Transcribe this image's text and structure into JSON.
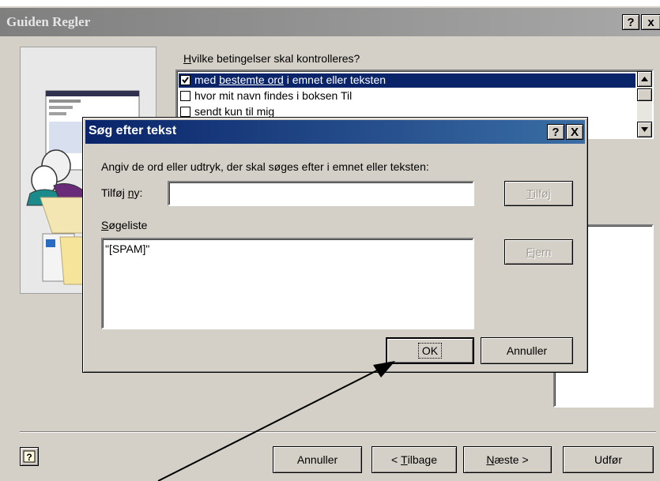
{
  "wizard": {
    "title": "Guiden Regler",
    "help_btn": "?",
    "close_btn": "x",
    "question_pre": "",
    "question_ul": "H",
    "question_post": "vilke betingelser skal kontrolleres?",
    "conditions": [
      {
        "checked": true,
        "pre": "med ",
        "ul": "bestemte ord",
        "post": " i emnet eller teksten",
        "selected": true
      },
      {
        "checked": false,
        "pre": "hvor mit navn findes i boksen Til",
        "ul": "",
        "post": "",
        "selected": false
      },
      {
        "checked": false,
        "pre": "sendt kun til mig",
        "ul": "",
        "post": "",
        "selected": false
      }
    ],
    "buttons": {
      "cancel": "Annuller",
      "back_pre": "< ",
      "back_ul": "T",
      "back_post": "ilbage",
      "next_ul": "N",
      "next_post": "æste >",
      "finish": "Udfør"
    },
    "help_icon": "help-question-icon"
  },
  "dialog": {
    "title": "Søg efter tekst",
    "help_btn": "?",
    "close_btn": "X",
    "instruction": "Angiv de ord eller udtryk, der skal søges efter i emnet eller teksten:",
    "add_label_pre": "Tilføj ",
    "add_label_ul": "n",
    "add_label_post": "y:",
    "add_value": "",
    "add_btn_ul": "T",
    "add_btn_post": "ilføj",
    "list_label_pre": "",
    "list_label_ul": "S",
    "list_label_post": "øgeliste",
    "list_items": [
      "\"[SPAM]\""
    ],
    "remove_btn_ul": "F",
    "remove_btn_post": "jern",
    "ok": "OK",
    "cancel": "Annuller"
  },
  "colors": {
    "titlebar": "#0a246a",
    "dialog_bg": "#d4d0c8",
    "selection": "#0a246a",
    "arrow": "#000000"
  }
}
